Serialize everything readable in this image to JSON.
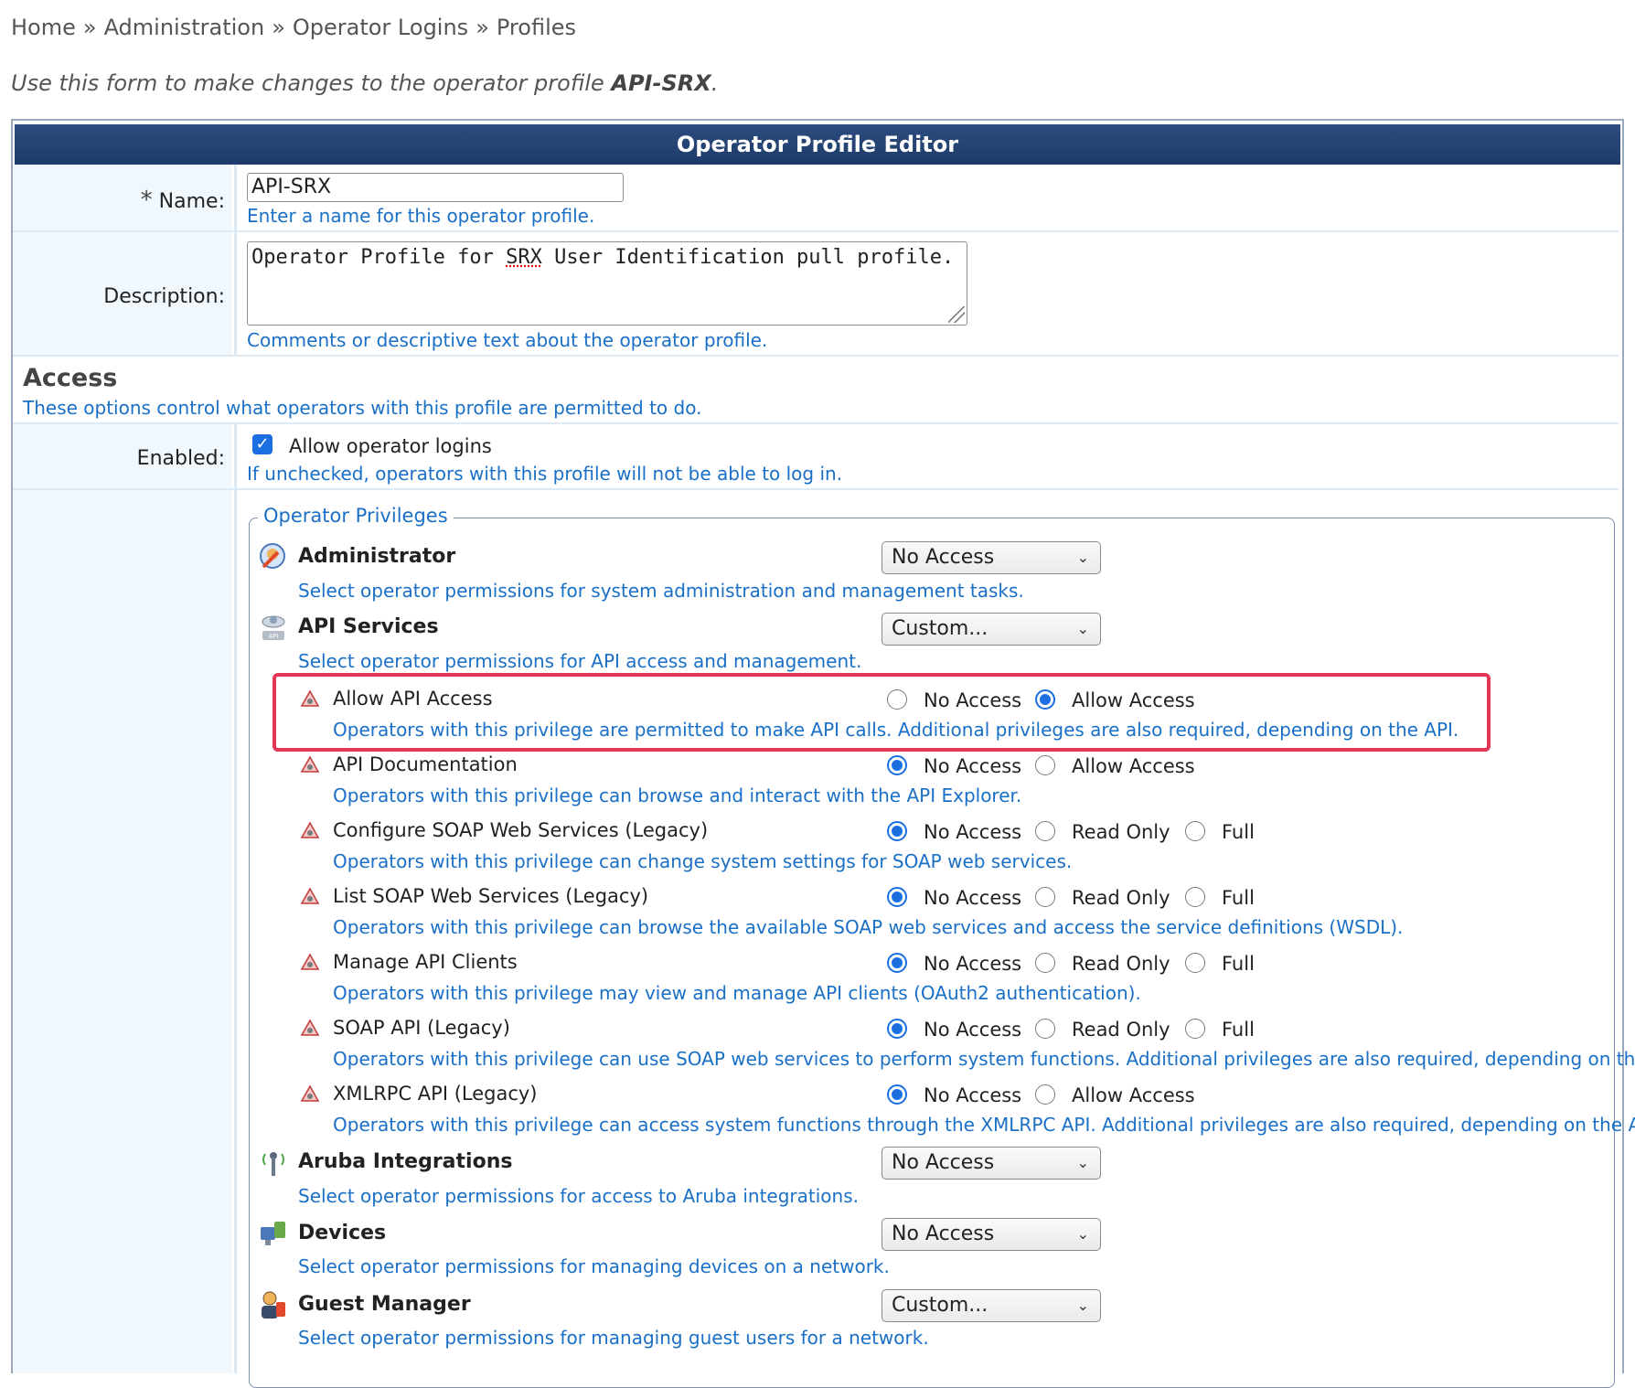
{
  "breadcrumb": {
    "items": [
      "Home",
      "Administration",
      "Operator Logins",
      "Profiles"
    ],
    "separator": "»"
  },
  "intro": {
    "prefix": "Use this form to make changes to the operator profile ",
    "profile": "API-SRX",
    "suffix": "."
  },
  "editor": {
    "title": "Operator Profile Editor",
    "name_label": "Name:",
    "name_required_mark": "*",
    "name_value": "API-SRX",
    "name_help": "Enter a name for this operator profile.",
    "description_label": "Description:",
    "description_before": "Operator Profile for ",
    "description_flagged": "SRX",
    "description_after": " User Identification pull profile.",
    "description_help": "Comments or descriptive text about the operator profile."
  },
  "access": {
    "title": "Access",
    "help": "These options control what operators with this profile are permitted to do.",
    "enabled_label": "Enabled:",
    "checkbox_label": "Allow operator logins",
    "checkbox_checked": true,
    "checkbox_help": "If unchecked, operators with this profile will not be able to log in."
  },
  "privileges": {
    "legend": "Operator Privileges",
    "categories": [
      {
        "name": "Administrator",
        "value": "No Access",
        "help": "Select operator permissions for system administration and management tasks.",
        "icon": "administrator-icon"
      },
      {
        "name": "API Services",
        "value": "Custom...",
        "help": "Select operator permissions for API access and management.",
        "icon": "api-services-icon"
      },
      {
        "name": "Aruba Integrations",
        "value": "No Access",
        "help": "Select operator permissions for access to Aruba integrations.",
        "icon": "antenna-icon"
      },
      {
        "name": "Devices",
        "value": "No Access",
        "help": "Select operator permissions for managing devices on a network.",
        "icon": "devices-icon"
      },
      {
        "name": "Guest Manager",
        "value": "Custom...",
        "help": "Select operator permissions for managing guest users for a network.",
        "icon": "guest-manager-icon"
      }
    ],
    "api_items": [
      {
        "name": "Allow API Access",
        "options": [
          "No Access",
          "Allow Access"
        ],
        "selected": 1,
        "help": "Operators with this privilege are permitted to make API calls. Additional privileges are also required, depending on the API."
      },
      {
        "name": "API Documentation",
        "options": [
          "No Access",
          "Allow Access"
        ],
        "selected": 0,
        "help": "Operators with this privilege can browse and interact with the API Explorer."
      },
      {
        "name": "Configure SOAP Web Services (Legacy)",
        "options": [
          "No Access",
          "Read Only",
          "Full"
        ],
        "selected": 0,
        "help": "Operators with this privilege can change system settings for SOAP web services."
      },
      {
        "name": "List SOAP Web Services (Legacy)",
        "options": [
          "No Access",
          "Read Only",
          "Full"
        ],
        "selected": 0,
        "help": "Operators with this privilege can browse the available SOAP web services and access the service definitions (WSDL)."
      },
      {
        "name": "Manage API Clients",
        "options": [
          "No Access",
          "Read Only",
          "Full"
        ],
        "selected": 0,
        "help": "Operators with this privilege may view and manage API clients (OAuth2 authentication)."
      },
      {
        "name": "SOAP API (Legacy)",
        "options": [
          "No Access",
          "Read Only",
          "Full"
        ],
        "selected": 0,
        "help": "Operators with this privilege can use SOAP web services to perform system functions. Additional privileges are also required, depending on the API."
      },
      {
        "name": "XMLRPC API (Legacy)",
        "options": [
          "No Access",
          "Allow Access"
        ],
        "selected": 0,
        "help": "Operators with this privilege can access system functions through the XMLRPC API. Additional privileges are also required, depending on the API."
      }
    ]
  },
  "colors": {
    "header_bg": "#1d3a69",
    "help_text": "#1a6fc6",
    "highlight": "#e3375a",
    "label_bg": "#f1f8fd",
    "accent": "#1b6fe0"
  }
}
